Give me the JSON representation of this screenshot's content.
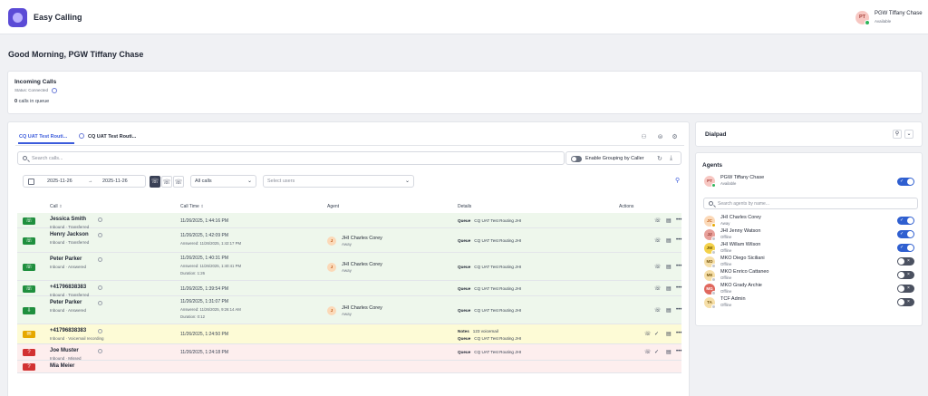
{
  "app": {
    "title": "Easy Calling"
  },
  "user": {
    "initials": "PT",
    "name": "PGW Tiffany Chase",
    "status": "Available",
    "status_color": "#2fb45a"
  },
  "greeting": "Good Morning, PGW Tiffany Chase",
  "incoming": {
    "title": "Incoming Calls",
    "status": "Status: Connected",
    "queue_count": "0",
    "queue_label": "calls in queue"
  },
  "tabs": [
    {
      "label": "CQ UAT Test Routi...",
      "active": true
    },
    {
      "label": "CQ UAT Test Routi...",
      "active": false
    }
  ],
  "toolbar": {
    "search_placeholder": "Search calls...",
    "grouping_label": "Enable Grouping by Caller",
    "date_from": "2025-11-26",
    "date_arrow": "→",
    "date_to": "2025-11-26",
    "call_filter": "All calls",
    "users_placeholder": "Select users"
  },
  "table": {
    "headers": {
      "call": "Call",
      "time": "Call Time",
      "agent": "Agent",
      "details": "Details",
      "actions": "Actions"
    },
    "rows": [
      {
        "color": "green",
        "icon": "phone-in-icon",
        "glyph": "☏",
        "caller": "Jessica Smith",
        "meta": "Inbound · Transferred",
        "time": "11/26/2025, 1:44:16 PM",
        "answered": "",
        "duration": "",
        "agent_initials": "",
        "agent": "",
        "agent_status": "",
        "details": [
          {
            "k": "Queue",
            "v": "CQ UAT Test Routing JHI"
          }
        ]
      },
      {
        "color": "green",
        "icon": "phone-in-icon",
        "glyph": "☏",
        "caller": "Henry Jackson",
        "meta": "Inbound · Transferred",
        "time": "11/26/2025, 1:42:09 PM",
        "answered": "Answered: 11/26/2025, 1:42:17 PM",
        "duration": "",
        "agent_initials": "J",
        "agent": "JHI Charles Corey",
        "agent_status": "Away",
        "details": [
          {
            "k": "Queue",
            "v": "CQ UAT Test Routing JHI"
          }
        ]
      },
      {
        "color": "green",
        "icon": "phone-in-icon",
        "glyph": "☏",
        "caller": "Peter Parker",
        "meta": "Inbound · Answered",
        "time": "11/26/2025, 1:40:31 PM",
        "answered": "Answered: 11/26/2025, 1:40:41 PM",
        "duration": "Duration: 1:26",
        "agent_initials": "J",
        "agent": "JHI Charles Corey",
        "agent_status": "Away",
        "details": [
          {
            "k": "Queue",
            "v": "CQ UAT Test Routing JHI"
          }
        ]
      },
      {
        "color": "green",
        "icon": "phone-in-icon",
        "glyph": "☏",
        "caller": "+41796838383",
        "meta": "Inbound · Transferred",
        "time": "11/26/2025, 1:39:54 PM",
        "answered": "",
        "duration": "",
        "agent_initials": "",
        "agent": "",
        "agent_status": "",
        "details": [
          {
            "k": "Queue",
            "v": "CQ UAT Test Routing JHI"
          }
        ]
      },
      {
        "color": "green",
        "icon": "phone-answered-icon",
        "glyph": "⇩",
        "caller": "Peter Parker",
        "meta": "Inbound · Answered",
        "time": "11/26/2025, 1:31:07 PM",
        "answered": "Answered: 11/26/2025, 9:26:14 AM",
        "duration": "Duration: 0:12",
        "agent_initials": "J",
        "agent": "JHI Charles Corey",
        "agent_status": "Away",
        "details": [
          {
            "k": "Queue",
            "v": "CQ UAT Test Routing JHI"
          }
        ]
      },
      {
        "color": "yellow",
        "icon": "voicemail-icon",
        "glyph": "✉",
        "caller": "+41796838383",
        "meta": "Inbound · Voicemail recording",
        "time": "11/26/2025, 1:24:50 PM",
        "answered": "",
        "duration": "",
        "agent_initials": "",
        "agent": "",
        "agent_status": "",
        "details": [
          {
            "k": "Notes",
            "v": "123 voicemail"
          },
          {
            "k": "Queue",
            "v": "CQ UAT Test Routing JHI"
          }
        ]
      },
      {
        "color": "red",
        "icon": "phone-missed-icon",
        "glyph": "?",
        "caller": "Joe Muster",
        "meta": "Inbound · Missed",
        "time": "11/26/2025, 1:24:18 PM",
        "answered": "",
        "duration": "",
        "agent_initials": "",
        "agent": "",
        "agent_status": "",
        "details": [
          {
            "k": "Queue",
            "v": "CQ UAT Test Routing JHI"
          }
        ]
      },
      {
        "color": "red",
        "icon": "phone-missed-icon",
        "glyph": "?",
        "caller": "Mia Meier",
        "meta": "",
        "time": "",
        "answered": "",
        "duration": "",
        "agent_initials": "",
        "agent": "",
        "agent_status": "",
        "details": []
      }
    ]
  },
  "dialpad": {
    "title": "Dialpad"
  },
  "agents": {
    "title": "Agents",
    "me": {
      "initials": "PT",
      "name": "PGW Tiffany Chase",
      "status": "Available",
      "enabled": true
    },
    "search_placeholder": "Search agents by name...",
    "list": [
      {
        "initials": "JC",
        "name": "JHI Charles Corey",
        "status": "Away",
        "enabled": true,
        "bg": "#fbd9b8",
        "fg": "#c05a16",
        "dot": "#e6a800"
      },
      {
        "initials": "JJ",
        "name": "JHI Jenny Watson",
        "status": "Offline",
        "enabled": true,
        "bg": "#e8a09a",
        "fg": "#8a2a24",
        "dot": "#c5c8cf"
      },
      {
        "initials": "JW",
        "name": "JHI Willam Wilson",
        "status": "Offline",
        "enabled": true,
        "bg": "#f3d14a",
        "fg": "#6b5200",
        "dot": "#c5c8cf"
      },
      {
        "initials": "MD",
        "name": "MKO Diego Siciliani",
        "status": "Offline",
        "enabled": false,
        "bg": "#f6dfa8",
        "fg": "#7a5a12",
        "dot": "#c5c8cf"
      },
      {
        "initials": "ME",
        "name": "MKO Enrico Cattaneo",
        "status": "Offline",
        "enabled": false,
        "bg": "#f6dfa8",
        "fg": "#7a5a12",
        "dot": "#c5c8cf"
      },
      {
        "initials": "MG",
        "name": "MKO Grady Archie",
        "status": "Offline",
        "enabled": false,
        "bg": "#e0685e",
        "fg": "#fff",
        "dot": "#c5c8cf"
      },
      {
        "initials": "TA",
        "name": "TCF Admin",
        "status": "Offline",
        "enabled": false,
        "bg": "#f6dfa8",
        "fg": "#7a5a12",
        "dot": "#c5c8cf"
      }
    ]
  }
}
